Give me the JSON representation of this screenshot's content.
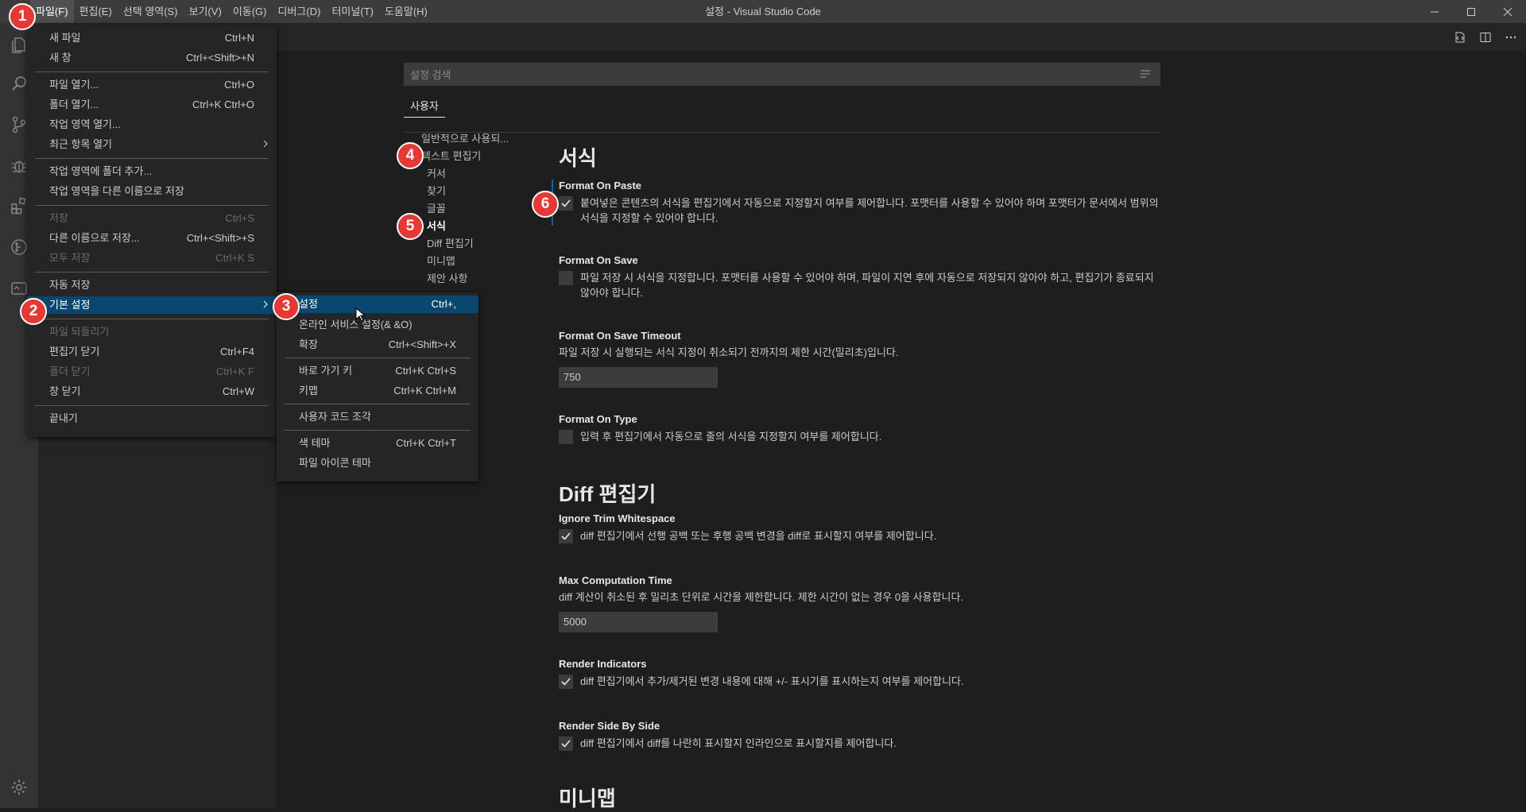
{
  "window": {
    "title": "설정 - Visual Studio Code",
    "controls": [
      "minimize-icon",
      "maximize-icon",
      "close-icon"
    ]
  },
  "menubar": [
    "파일(F)",
    "편집(E)",
    "선택 영역(S)",
    "보기(V)",
    "이동(G)",
    "디버그(D)",
    "터미널(T)",
    "도움말(H)"
  ],
  "activity_bar": [
    "files-icon",
    "search-icon",
    "source-control-icon",
    "debug-icon",
    "extensions-icon",
    "git-history-icon",
    "remote-icon",
    "gear-icon"
  ],
  "settings": {
    "search_placeholder": "설정 검색",
    "tab_user": "사용자",
    "toc": [
      "일반적으로 사용되...",
      "텍스트 편집기",
      "커서",
      "찾기",
      "글꼴",
      "서식",
      "Diff 편집기",
      "미니맵",
      "제안 사항"
    ],
    "section_format": "서식",
    "section_diff": "Diff 편집기",
    "section_minimap": "미니맵",
    "items": [
      {
        "name": "Format On Paste",
        "desc": "붙여넣은 콘텐츠의 서식을 편집기에서 자동으로 지정할지 여부를 제어합니다. 포맷터를 사용할 수 있어야 하며 포맷터가 문서에서 범위의 서식을 지정할 수 있어야 합니다.",
        "checked": true
      },
      {
        "name": "Format On Save",
        "desc": "파일 저장 시 서식을 지정합니다. 포맷터를 사용할 수 있어야 하며, 파일이 지연 후에 자동으로 저장되지 않아야 하고, 편집기가 종료되지 않아야 합니다.",
        "checked": false
      },
      {
        "name": "Format On Save Timeout",
        "desc": "파일 저장 시 실행되는 서식 지정이 취소되기 전까지의 제한 시간(밀리초)입니다.",
        "value": "750"
      },
      {
        "name": "Format On Type",
        "desc": "입력 후 편집기에서 자동으로 줄의 서식을 지정할지 여부를 제어합니다.",
        "checked": false
      },
      {
        "name": "Ignore Trim Whitespace",
        "desc": "diff 편집기에서 선행 공백 또는 후행 공백 변경을 diff로 표시할지 여부를 제어합니다.",
        "checked": true
      },
      {
        "name": "Max Computation Time",
        "desc": "diff 계산이 취소된 후 밀리초 단위로 시간을 제한합니다. 제한 시간이 없는 경우 0을 사용합니다.",
        "value": "5000"
      },
      {
        "name": "Render Indicators",
        "desc": "diff 편집기에서 추가/제거된 변경 내용에 대해 +/- 표시기를 표시하는지 여부를 제어합니다.",
        "checked": true
      },
      {
        "name": "Render Side By Side",
        "desc": "diff 편집기에서 diff를 나란히 표시할지 인라인으로 표시할지를 제어합니다.",
        "checked": true
      }
    ]
  },
  "file_menu": [
    {
      "label": "새 파일",
      "shortcut": "Ctrl+N"
    },
    {
      "label": "새 창",
      "shortcut": "Ctrl+<Shift>+N"
    },
    {
      "label": "파일 열기...",
      "shortcut": "Ctrl+O"
    },
    {
      "label": "폴더 열기...",
      "shortcut": "Ctrl+K Ctrl+O"
    },
    {
      "label": "작업 영역 열기...",
      "shortcut": ""
    },
    {
      "label": "최근 항목 열기",
      "shortcut": ""
    },
    {
      "label": "작업 영역에 폴더 추가...",
      "shortcut": ""
    },
    {
      "label": "작업 영역을 다른 이름으로 저장",
      "shortcut": ""
    },
    {
      "label": "저장",
      "shortcut": "Ctrl+S"
    },
    {
      "label": "다른 이름으로 저장...",
      "shortcut": "Ctrl+<Shift>+S"
    },
    {
      "label": "모두 저장",
      "shortcut": "Ctrl+K S"
    },
    {
      "label": "자동 저장",
      "shortcut": ""
    },
    {
      "label": "기본 설정",
      "shortcut": ""
    },
    {
      "label": "파일 되돌리기",
      "shortcut": ""
    },
    {
      "label": "편집기 닫기",
      "shortcut": "Ctrl+F4"
    },
    {
      "label": "폴더 닫기",
      "shortcut": "Ctrl+K F"
    },
    {
      "label": "창 닫기",
      "shortcut": "Ctrl+W"
    },
    {
      "label": "끝내기",
      "shortcut": ""
    }
  ],
  "prefs_menu": [
    {
      "label": "설정",
      "shortcut": "Ctrl+,"
    },
    {
      "label": "온라인 서비스 설정(& &O)",
      "shortcut": ""
    },
    {
      "label": "확장",
      "shortcut": "Ctrl+<Shift>+X"
    },
    {
      "label": "바로 가기 키",
      "shortcut": "Ctrl+K Ctrl+S"
    },
    {
      "label": "키맵",
      "shortcut": "Ctrl+K Ctrl+M"
    },
    {
      "label": "사용자 코드 조각",
      "shortcut": ""
    },
    {
      "label": "색 테마",
      "shortcut": "Ctrl+K Ctrl+T"
    },
    {
      "label": "파일 아이콘 테마",
      "shortcut": ""
    }
  ],
  "annotations": [
    "1",
    "2",
    "3",
    "4",
    "5",
    "6"
  ],
  "colors": {
    "highlight": "#094771",
    "badge": "#e53935",
    "accent": "#0e639c"
  }
}
